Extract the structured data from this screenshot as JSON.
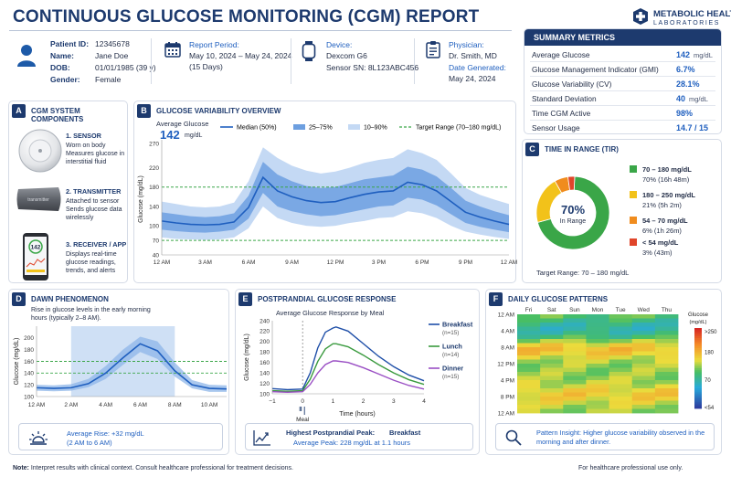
{
  "header": {
    "title": "CONTINUOUS GLUCOSE MONITORING (CGM) REPORT",
    "logo_line1": "METABOLIC HEALTH",
    "logo_line2": "LABORATORIES"
  },
  "patient": {
    "id_label": "Patient ID:",
    "id": "12345678",
    "name_label": "Name:",
    "name": "Jane Doe",
    "dob_label": "DOB:",
    "dob": "01/01/1985 (39 y)",
    "gender_label": "Gender:",
    "gender": "Female"
  },
  "report_period": {
    "label": "Report Period:",
    "range": "May 10, 2024 – May 24, 2024",
    "days": "(15 Days)"
  },
  "device": {
    "label": "Device:",
    "name": "Dexcom G6",
    "sensor": "Sensor SN: 8L123ABC456"
  },
  "physician": {
    "label": "Physician:",
    "name": "Dr. Smith, MD",
    "date_label": "Date Generated:",
    "date": "May 24, 2024"
  },
  "summary": {
    "title": "SUMMARY METRICS",
    "rows": [
      {
        "label": "Average Glucose",
        "value": "142",
        "unit": "mg/dL"
      },
      {
        "label": "Glucose Management Indicator (GMI)",
        "value": "6.7%",
        "unit": ""
      },
      {
        "label": "Glucose Variability (CV)",
        "value": "28.1%",
        "unit": ""
      },
      {
        "label": "Standard Deviation",
        "value": "40",
        "unit": "mg/dL"
      },
      {
        "label": "Time CGM Active",
        "value": "98%",
        "unit": ""
      },
      {
        "label": "Sensor Usage",
        "value": "14.7 / 15 days",
        "unit": ""
      }
    ]
  },
  "sections": {
    "a": {
      "badge": "A",
      "title": "CGM SYSTEM COMPONENTS"
    },
    "b": {
      "badge": "B",
      "title": "GLUCOSE VARIABILITY OVERVIEW"
    },
    "c": {
      "badge": "C",
      "title": "TIME IN RANGE (TIR)"
    },
    "d": {
      "badge": "D",
      "title": "DAWN PHENOMENON"
    },
    "e": {
      "badge": "E",
      "title": "POSTPRANDIAL GLUCOSE RESPONSE"
    },
    "f": {
      "badge": "F",
      "title": "DAILY GLUCOSE PATTERNS"
    }
  },
  "components": [
    {
      "title": "1. SENSOR",
      "desc1": "Worn on body",
      "desc2": "Measures glucose in",
      "desc3": "interstitial fluid"
    },
    {
      "title": "2. TRANSMITTER",
      "desc1": "Attached to sensor",
      "desc2": "Sends glucose data",
      "desc3": "wirelessly",
      "device_text": "transmitter"
    },
    {
      "title": "3. RECEIVER / APP",
      "desc1": "Displays real-time",
      "desc2": "glucose readings,",
      "desc3": "trends, and alerts",
      "screen_value": "142"
    }
  ],
  "icon_names": [
    "person-icon",
    "calendar-icon",
    "watch-icon",
    "clipboard-icon",
    "sun-icon",
    "trend-chart-icon",
    "magnifier-icon",
    "cross-logo-icon"
  ],
  "colors": {
    "navy": "#1d3a6e",
    "blue": "#1f5fbf",
    "median": "#1f5fbf",
    "band_25_75": "#6d9fe0",
    "band_10_90": "#c4d9f4",
    "target": "#3aa648",
    "tir_in": "#3aa648",
    "tir_180_250": "#f2c21a",
    "tir_54_70": "#f08c1e",
    "tir_lt54": "#e0452a"
  },
  "chart_data": [
    {
      "id": "glucose_variability",
      "type": "area",
      "average_label": "Average Glucose",
      "average_value": "142",
      "average_unit": "mg/dL",
      "ylabel": "Glucose (mg/dL)",
      "ylim": [
        40,
        270
      ],
      "yticks": [
        40,
        70,
        100,
        140,
        180,
        220,
        270
      ],
      "xlim": [
        0,
        24
      ],
      "xticks": [
        "12 AM",
        "3 AM",
        "6 AM",
        "9 AM",
        "12 PM",
        "3 PM",
        "6 PM",
        "9 PM",
        "12 AM"
      ],
      "legend": [
        "Median (50%)",
        "25–75%",
        "10–90%",
        "Target Range (70–180 mg/dL)"
      ],
      "target_range": [
        70,
        180
      ],
      "x": [
        0,
        1,
        2,
        3,
        4,
        5,
        6,
        7,
        8,
        9,
        10,
        11,
        12,
        13,
        14,
        15,
        16,
        17,
        18,
        19,
        20,
        21,
        22,
        23,
        24
      ],
      "series": [
        {
          "name": "Median (50%)",
          "values": [
            110,
            106,
            103,
            102,
            103,
            108,
            138,
            200,
            172,
            160,
            152,
            148,
            150,
            158,
            165,
            170,
            172,
            190,
            185,
            172,
            150,
            128,
            118,
            110,
            103
          ]
        },
        {
          "name": "25–75%",
          "low": [
            92,
            89,
            87,
            86,
            88,
            92,
            115,
            168,
            140,
            130,
            124,
            120,
            122,
            128,
            134,
            140,
            142,
            158,
            154,
            142,
            124,
            106,
            98,
            92,
            87
          ],
          "high": [
            128,
            124,
            120,
            118,
            120,
            126,
            162,
            232,
            206,
            192,
            182,
            178,
            180,
            188,
            196,
            200,
            204,
            222,
            216,
            202,
            178,
            152,
            140,
            130,
            122
          ]
        },
        {
          "name": "10–90%",
          "low": [
            76,
            73,
            72,
            71,
            72,
            76,
            95,
            140,
            116,
            106,
            100,
            98,
            100,
            106,
            110,
            116,
            118,
            130,
            126,
            116,
            100,
            88,
            82,
            77,
            73
          ],
          "high": [
            150,
            145,
            140,
            138,
            140,
            148,
            192,
            262,
            240,
            224,
            214,
            208,
            212,
            220,
            230,
            236,
            240,
            258,
            250,
            236,
            208,
            178,
            164,
            154,
            145
          ]
        }
      ]
    },
    {
      "id": "time_in_range",
      "type": "pie",
      "center_value": "70%",
      "center_label": "In Range",
      "target_text": "Target Range: 70 – 180 mg/dL",
      "slices": [
        {
          "label": "70 – 180 mg/dL",
          "value": 70,
          "detail": "70% (16h 48m)"
        },
        {
          "label": "180 – 250 mg/dL",
          "value": 21,
          "detail": "21% (5h 2m)"
        },
        {
          "label": "54 – 70 mg/dL",
          "value": 6,
          "detail": "6% (1h 26m)"
        },
        {
          "label": "< 54 mg/dL",
          "value": 3,
          "detail": "3% (43m)"
        }
      ]
    },
    {
      "id": "dawn_phenomenon",
      "type": "line",
      "description1": "Rise in glucose levels in the early morning",
      "description2": "hours (typically 2–8 AM).",
      "ylabel": "Glucose (mg/dL)",
      "ylim": [
        100,
        220
      ],
      "yticks": [
        100,
        120,
        140,
        160,
        180,
        200
      ],
      "xticks": [
        "12 AM",
        "2 AM",
        "4 AM",
        "6 AM",
        "8 AM",
        "10 AM"
      ],
      "x": [
        0,
        1,
        2,
        3,
        4,
        5,
        6,
        7,
        8,
        9,
        10,
        11
      ],
      "values": [
        115,
        114,
        115,
        122,
        140,
        166,
        190,
        178,
        144,
        120,
        114,
        113
      ],
      "band_low": [
        110,
        109,
        110,
        116,
        130,
        154,
        176,
        164,
        134,
        114,
        108,
        108
      ],
      "band_high": [
        120,
        119,
        121,
        130,
        152,
        180,
        202,
        194,
        158,
        128,
        120,
        119
      ],
      "highlight": [
        2,
        8
      ],
      "reference_lines": [
        160,
        140
      ],
      "note_title": "Average Rise: +32 mg/dL",
      "note_detail": "(2 AM to 6 AM)"
    },
    {
      "id": "postprandial",
      "type": "line",
      "title": "Average Glucose Response by Meal",
      "xlabel": "Time (hours)",
      "ylabel": "Glucose (mg/dL)",
      "ylim": [
        100,
        240
      ],
      "yticks": [
        100,
        120,
        140,
        160,
        180,
        200,
        220,
        240
      ],
      "xlim": [
        -1,
        4
      ],
      "xticks": [
        "−1",
        "0",
        "1",
        "2",
        "3",
        "4"
      ],
      "meal_label": "Meal",
      "x": [
        -1,
        -0.5,
        0,
        0.25,
        0.5,
        0.75,
        1,
        1.1,
        1.5,
        2,
        2.5,
        3,
        3.5,
        4
      ],
      "series": [
        {
          "name": "Breakfast",
          "n": "(n=15)",
          "values": [
            110,
            108,
            109,
            140,
            188,
            218,
            226,
            228,
            220,
            196,
            172,
            152,
            136,
            125
          ]
        },
        {
          "name": "Lunch",
          "n": "(n=14)",
          "values": [
            106,
            105,
            106,
            128,
            162,
            186,
            196,
            196,
            190,
            174,
            156,
            140,
            127,
            118
          ]
        },
        {
          "name": "Dinner",
          "n": "(n=15)",
          "values": [
            104,
            103,
            104,
            118,
            140,
            156,
            163,
            163,
            160,
            150,
            138,
            126,
            116,
            109
          ]
        }
      ],
      "note_title": "Highest Postprandial Peak:",
      "note_meal": "Breakfast",
      "note_detail": "Average Peak: 228 mg/dL at 1.1 hours"
    },
    {
      "id": "daily_patterns",
      "type": "heatmap",
      "columns": [
        "Fri",
        "Sat",
        "Sun",
        "Mon",
        "Tue",
        "Wed",
        "Thu"
      ],
      "rows": [
        "12 AM",
        "4 AM",
        "8 AM",
        "12 PM",
        "4 PM",
        "8 PM",
        "12 AM"
      ],
      "colorbar_title": "Glucose",
      "colorbar_unit": "(mg/dL)",
      "colorbar_ticks": [
        ">250",
        "180",
        "70",
        "<54"
      ],
      "note": "Pattern Insight: Higher glucose variability observed in the morning and after dinner."
    }
  ],
  "footer": {
    "note_label": "Note:",
    "note": "Interpret results with clinical context. Consult healthcare professional for treatment decisions.",
    "right": "For healthcare professional use only."
  }
}
